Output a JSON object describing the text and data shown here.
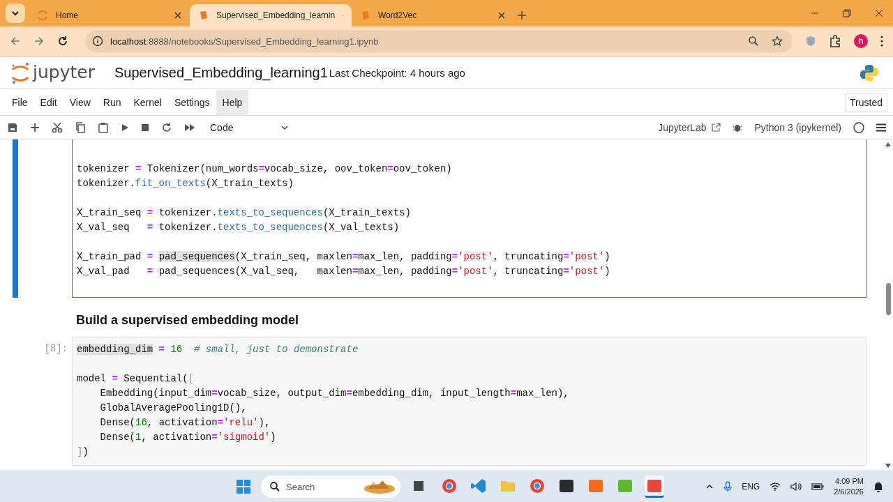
{
  "browser": {
    "tabs": [
      {
        "title": "Home",
        "kind": "jupyter",
        "selected": false
      },
      {
        "title": "Supervised_Embedding_learnin",
        "kind": "notebook",
        "selected": true
      },
      {
        "title": "Word2Vec",
        "kind": "notebook",
        "selected": false
      }
    ],
    "url_host": "localhost",
    "url_rest": ":8888/notebooks/Supervised_Embedding_learning1.ipynb",
    "profile_initial": "h"
  },
  "header": {
    "notebook_name": "Supervised_Embedding_learning1",
    "checkpoint": "Last Checkpoint: 4 hours ago"
  },
  "menu": [
    {
      "label": "File",
      "selected": false
    },
    {
      "label": "Edit",
      "selected": false
    },
    {
      "label": "View",
      "selected": false
    },
    {
      "label": "Run",
      "selected": false
    },
    {
      "label": "Kernel",
      "selected": false
    },
    {
      "label": "Settings",
      "selected": false
    },
    {
      "label": "Help",
      "selected": true
    }
  ],
  "trusted": "Trusted",
  "toolbar": {
    "cell_type": "Code",
    "jupyterlab": "JupyterLab",
    "kernel": "Python 3 (ipykernel)",
    "kernel_busy": false
  },
  "cells": [
    {
      "kind": "code",
      "active": true,
      "lines": [
        {
          "kind": "code",
          "tokens": [
            {
              "kind": "plain",
              "text": "tokenizer "
            },
            {
              "kind": "op",
              "text": "="
            },
            {
              "kind": "plain",
              "text": " Tokenizer(num_words"
            },
            {
              "kind": "op",
              "text": "="
            },
            {
              "kind": "plain",
              "text": "vocab_size, oov_token"
            },
            {
              "kind": "op",
              "text": "="
            },
            {
              "kind": "plain",
              "text": "oov_token)"
            }
          ]
        },
        {
          "kind": "code",
          "tokens": [
            {
              "kind": "plain",
              "text": "tokenizer."
            },
            {
              "kind": "fn",
              "text": "fit_on_texts"
            },
            {
              "kind": "plain",
              "text": "(X_train_texts)"
            }
          ]
        },
        {
          "kind": "blank"
        },
        {
          "kind": "code",
          "tokens": [
            {
              "kind": "plain",
              "text": "X_train_seq "
            },
            {
              "kind": "op",
              "text": "="
            },
            {
              "kind": "plain",
              "text": " tokenizer."
            },
            {
              "kind": "fn",
              "text": "texts_to_sequences"
            },
            {
              "kind": "plain",
              "text": "(X_train_texts)"
            }
          ]
        },
        {
          "kind": "code",
          "tokens": [
            {
              "kind": "plain",
              "text": "X_val_seq   "
            },
            {
              "kind": "op",
              "text": "="
            },
            {
              "kind": "plain",
              "text": " tokenizer."
            },
            {
              "kind": "fn",
              "text": "texts_to_sequences"
            },
            {
              "kind": "plain",
              "text": "(X_val_texts)"
            }
          ]
        },
        {
          "kind": "blank"
        },
        {
          "kind": "code",
          "tokens": [
            {
              "kind": "plain",
              "text": "X_train_pad "
            },
            {
              "kind": "op",
              "text": "= "
            },
            {
              "kind": "hl",
              "text": "pad_sequences"
            },
            {
              "kind": "plain",
              "text": "(X_train_seq, maxlen"
            },
            {
              "kind": "op",
              "text": "="
            },
            {
              "kind": "plain",
              "text": "max_len, padding"
            },
            {
              "kind": "op",
              "text": "="
            },
            {
              "kind": "str",
              "text": "'post'"
            },
            {
              "kind": "plain",
              "text": ", truncating"
            },
            {
              "kind": "op",
              "text": "="
            },
            {
              "kind": "str",
              "text": "'post'"
            },
            {
              "kind": "plain",
              "text": ")"
            }
          ]
        },
        {
          "kind": "code",
          "tokens": [
            {
              "kind": "plain",
              "text": "X_val_pad   "
            },
            {
              "kind": "op",
              "text": "="
            },
            {
              "kind": "plain",
              "text": " pad_sequences(X_val_seq,   maxlen"
            },
            {
              "kind": "op",
              "text": "="
            },
            {
              "kind": "plain",
              "text": "max_len, padding"
            },
            {
              "kind": "op",
              "text": "="
            },
            {
              "kind": "str",
              "text": "'post'"
            },
            {
              "kind": "plain",
              "text": ", truncating"
            },
            {
              "kind": "op",
              "text": "="
            },
            {
              "kind": "str",
              "text": "'post'"
            },
            {
              "kind": "plain",
              "text": ")"
            }
          ]
        }
      ]
    },
    {
      "kind": "markdown",
      "heading": "Build a supervised embedding model"
    },
    {
      "kind": "code",
      "prompt": "[8]:",
      "active": false,
      "lines": [
        {
          "kind": "code",
          "tokens": [
            {
              "kind": "hl",
              "text": "embedding_dim"
            },
            {
              "kind": "op",
              "text": " = "
            },
            {
              "kind": "num",
              "text": "16"
            },
            {
              "kind": "comment",
              "text": "  # small, just to demonstrate"
            }
          ]
        },
        {
          "kind": "blank"
        },
        {
          "kind": "code",
          "tokens": [
            {
              "kind": "plain",
              "text": "model "
            },
            {
              "kind": "op",
              "text": "="
            },
            {
              "kind": "plain",
              "text": " Sequential("
            },
            {
              "kind": "bracket",
              "text": "["
            }
          ]
        },
        {
          "kind": "code",
          "tokens": [
            {
              "kind": "plain",
              "text": "    Embedding(input_dim"
            },
            {
              "kind": "op",
              "text": "="
            },
            {
              "kind": "plain",
              "text": "vocab_size, output_dim"
            },
            {
              "kind": "op",
              "text": "="
            },
            {
              "kind": "plain",
              "text": "embedding_dim, input_length"
            },
            {
              "kind": "op",
              "text": "="
            },
            {
              "kind": "plain",
              "text": "max_len),"
            }
          ]
        },
        {
          "kind": "code",
          "tokens": [
            {
              "kind": "plain",
              "text": "    GlobalAveragePooling1D(),"
            }
          ]
        },
        {
          "kind": "code",
          "tokens": [
            {
              "kind": "plain",
              "text": "    Dense("
            },
            {
              "kind": "num",
              "text": "16"
            },
            {
              "kind": "plain",
              "text": ", activation"
            },
            {
              "kind": "op",
              "text": "="
            },
            {
              "kind": "str",
              "text": "'relu'"
            },
            {
              "kind": "plain",
              "text": "),"
            }
          ]
        },
        {
          "kind": "code",
          "tokens": [
            {
              "kind": "plain",
              "text": "    Dense("
            },
            {
              "kind": "num",
              "text": "1"
            },
            {
              "kind": "plain",
              "text": ", activation"
            },
            {
              "kind": "op",
              "text": "="
            },
            {
              "kind": "str",
              "text": "'sigmoid'"
            },
            {
              "kind": "plain",
              "text": ")"
            }
          ]
        },
        {
          "kind": "code",
          "tokens": [
            {
              "kind": "bracket",
              "text": "]"
            },
            {
              "kind": "plain",
              "text": ")"
            }
          ]
        }
      ]
    }
  ],
  "taskbar": {
    "search_placeholder": "Search",
    "apps": [
      {
        "kind": "files-dark",
        "selected": false
      },
      {
        "kind": "chrome",
        "selected": false
      },
      {
        "kind": "vscode",
        "selected": false
      },
      {
        "kind": "folder",
        "selected": false
      },
      {
        "kind": "chrome",
        "selected": false
      },
      {
        "kind": "terminal",
        "selected": false
      },
      {
        "kind": "orange-app",
        "selected": false
      },
      {
        "kind": "green-app",
        "selected": false
      },
      {
        "kind": "red-app",
        "selected": true
      }
    ],
    "language": "ENG",
    "time": "4:09 PM",
    "date": "2/6/2026"
  }
}
